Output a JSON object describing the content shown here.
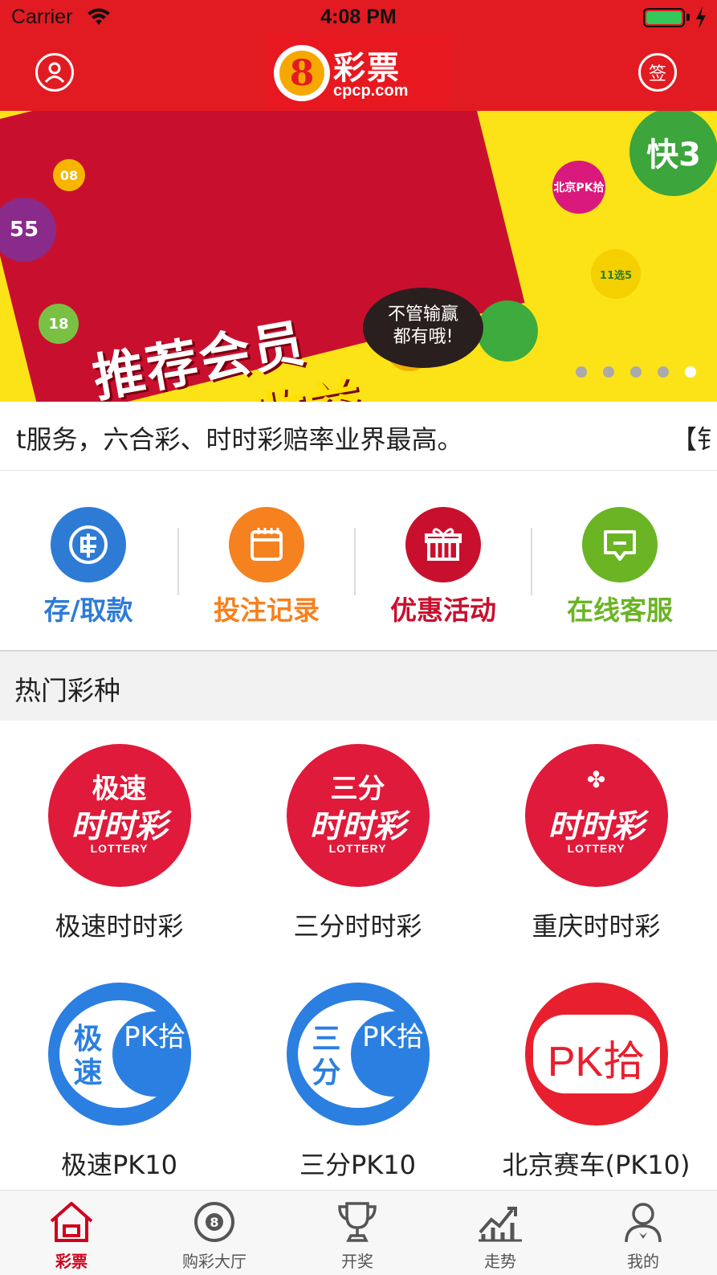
{
  "status_bar": {
    "carrier": "Carrier",
    "time": "4:08 PM",
    "battery_level": 1.0
  },
  "header": {
    "logo": {
      "name": "彩票",
      "url": "cpcp.com",
      "digit": "8"
    },
    "sign_label": "签"
  },
  "banner": {
    "headline_1": "推荐会员",
    "headline_2": "得永久收益",
    "bubble": [
      "不管输赢",
      "都有哦!"
    ],
    "balls": [
      "55",
      "08",
      "18",
      "北京PK拾",
      "11选5",
      "快3"
    ],
    "dots_count": 5,
    "active_dot": 5
  },
  "marquee": {
    "text": "t服务，六合彩、时时彩赔率业界最高。",
    "tail": "【钅"
  },
  "quick_actions": [
    {
      "label": "存/取款",
      "color": "#2e7bd6",
      "icon": "wallet-icon"
    },
    {
      "label": "投注记录",
      "color": "#f5811f",
      "icon": "calendar-icon"
    },
    {
      "label": "优惠活动",
      "color": "#c8102e",
      "icon": "gift-icon"
    },
    {
      "label": "在线客服",
      "color": "#6bb424",
      "icon": "chat-icon"
    }
  ],
  "section_title": "热门彩种",
  "lotteries": [
    {
      "name": "极速时时彩",
      "badge_top": "极速",
      "badge_script": "时时彩",
      "badge_sub": "LOTTERY"
    },
    {
      "name": "三分时时彩",
      "badge_top": "三分",
      "badge_script": "时时彩",
      "badge_sub": "LOTTERY"
    },
    {
      "name": "重庆时时彩",
      "badge_top": "",
      "badge_script": "时时彩",
      "badge_sub": "LOTTERY"
    },
    {
      "name": "极速PK10",
      "badge_left": "极速",
      "badge_right": "PK拾"
    },
    {
      "name": "三分PK10",
      "badge_left": "三分",
      "badge_right": "PK拾"
    },
    {
      "name": "北京赛车(PK10)",
      "badge_text": "PK拾"
    }
  ],
  "tabs": [
    {
      "label": "彩票",
      "icon": "home-icon",
      "active": true
    },
    {
      "label": "购彩大厅",
      "icon": "eight-ball-icon",
      "active": false
    },
    {
      "label": "开奖",
      "icon": "trophy-icon",
      "active": false
    },
    {
      "label": "走势",
      "icon": "trend-chart-icon",
      "active": false
    },
    {
      "label": "我的",
      "icon": "person-icon",
      "active": false
    }
  ],
  "colors": {
    "brand_red": "#e21b22",
    "active_tab": "#d0021b",
    "banner_yellow": "#fbe318"
  }
}
